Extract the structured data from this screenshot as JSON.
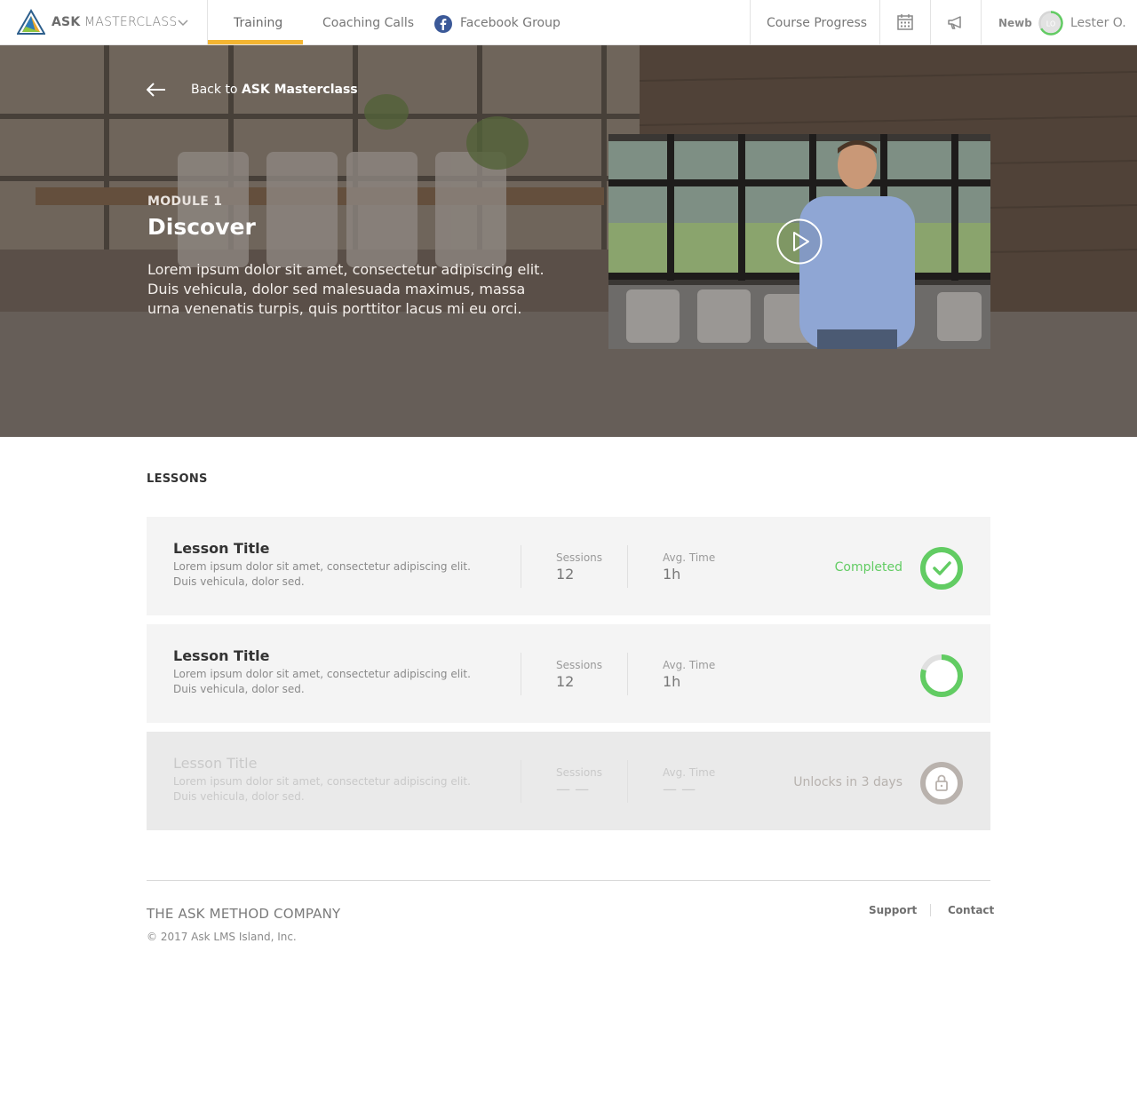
{
  "nav": {
    "brand_bold": "ASK",
    "brand_light": "MASTERCLASS",
    "tabs": [
      {
        "label": "Training",
        "active": true
      },
      {
        "label": "Coaching Calls",
        "active": false
      },
      {
        "label": "Facebook Group",
        "active": false
      }
    ],
    "course_progress": "Course Progress",
    "rank": "Newb",
    "avatar_initials": "LO",
    "username": "Lester O."
  },
  "hero": {
    "back_prefix": "Back to ",
    "back_target": "ASK Masterclass",
    "module_label": "MODULE 1",
    "module_title": "Discover",
    "module_description": "Lorem ipsum dolor sit amet, consectetur adipiscing elit. Duis vehicula, dolor sed malesuada maximus, massa urna venenatis turpis, quis porttitor lacus mi eu orci."
  },
  "lessons": {
    "section_title": "LESSONS",
    "items": [
      {
        "title": "Lesson Title",
        "description": "Lorem ipsum dolor sit amet, consectetur adipiscing elit. Duis vehicula, dolor sed.",
        "sessions_label": "Sessions",
        "sessions_value": "12",
        "time_label": "Avg. Time",
        "time_value": "1h",
        "status": "completed",
        "status_text": "Completed",
        "progress": 1.0
      },
      {
        "title": "Lesson Title",
        "description": "Lorem ipsum dolor sit amet, consectetur adipiscing elit. Duis vehicula, dolor sed.",
        "sessions_label": "Sessions",
        "sessions_value": "12",
        "time_label": "Avg. Time",
        "time_value": "1h",
        "status": "in-progress",
        "status_text": "",
        "progress": 0.8
      },
      {
        "title": "Lesson Title",
        "description": "Lorem ipsum dolor sit amet, consectetur adipiscing elit. Duis vehicula, dolor sed.",
        "sessions_label": "Sessions",
        "sessions_value": "— —",
        "time_label": "Avg. Time",
        "time_value": "— —",
        "status": "locked",
        "status_text": "Unlocks in 3 days",
        "progress": 0
      }
    ]
  },
  "footer": {
    "company": "THE ASK METHOD COMPANY",
    "copyright": "© 2017 Ask LMS Island, Inc.",
    "links": [
      "Support",
      "Contact"
    ]
  },
  "colors": {
    "accent": "#f3b532",
    "success": "#62cc63",
    "facebook": "#3b5998",
    "locked": "#b9b2ad"
  }
}
